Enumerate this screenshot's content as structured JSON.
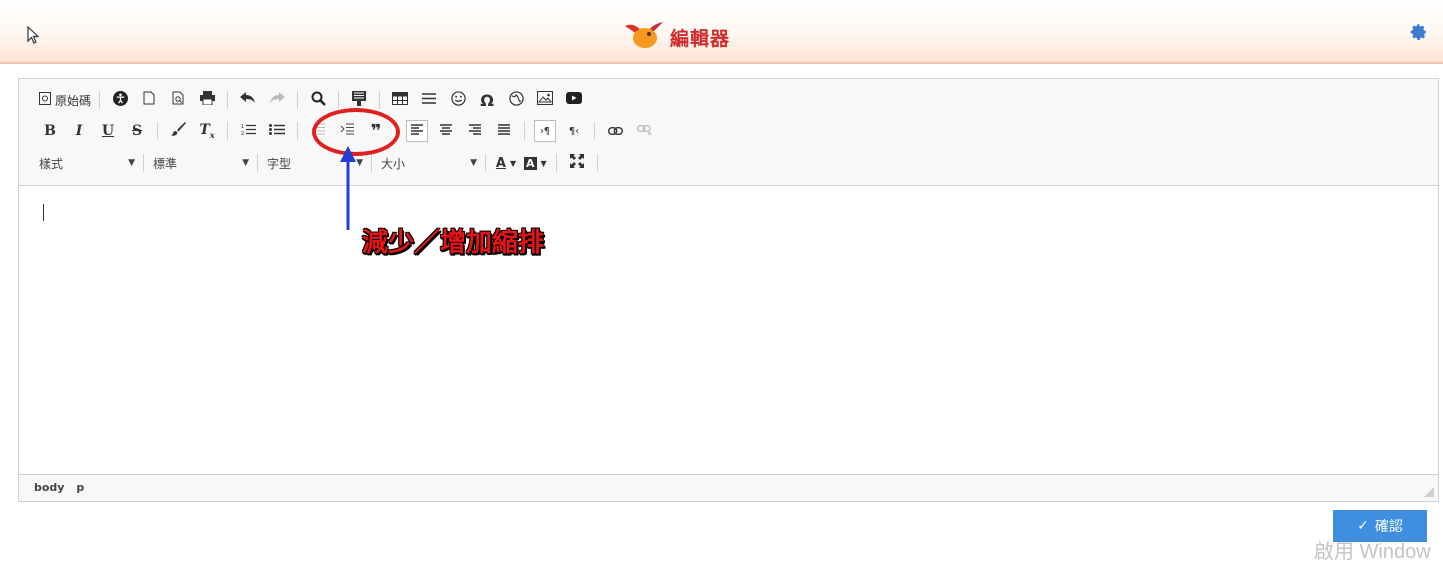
{
  "header": {
    "title": "編輯器"
  },
  "toolbar": {
    "source_label": "原始碼",
    "style_combo": "樣式",
    "format_combo": "標準",
    "font_combo": "字型",
    "size_combo": "大小"
  },
  "statusbar": {
    "path": [
      "body",
      "p"
    ]
  },
  "annotation": {
    "text": "減少／增加縮排"
  },
  "actions": {
    "confirm_label": "確認"
  },
  "watermark": "啟用 Window",
  "colors": {
    "accent": "#3f8fe0",
    "annotation_red": "#e02020",
    "annotation_blue": "#1f3fd6",
    "title_red": "#d22b2b"
  }
}
